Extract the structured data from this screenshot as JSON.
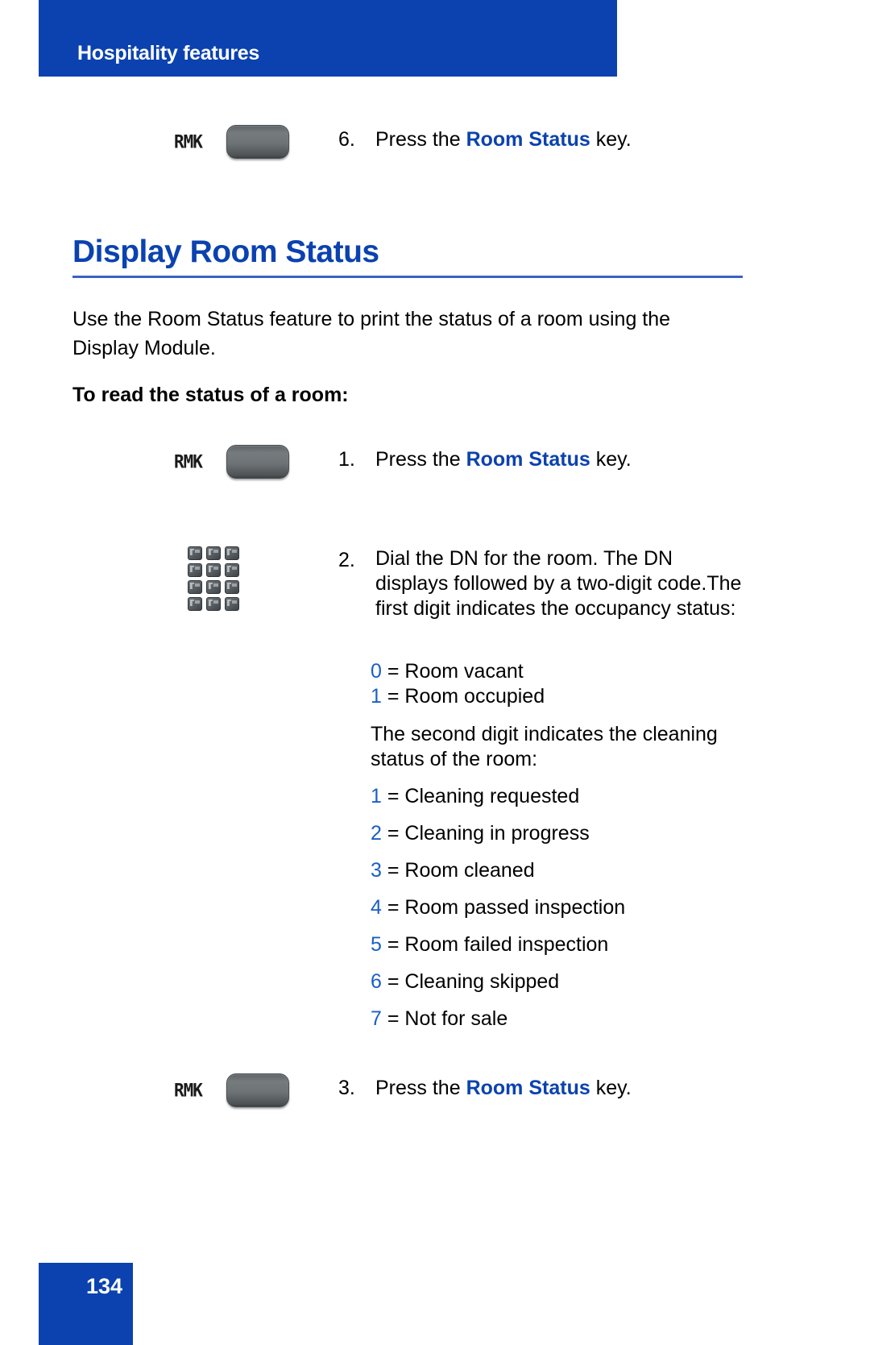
{
  "header": {
    "title": "Hospitality features"
  },
  "top_step": {
    "number": "6.",
    "icon_label": "RMK",
    "text_before": "Press the ",
    "keyword": "Room Status",
    "text_after": " key."
  },
  "section": {
    "heading": "Display Room Status",
    "intro": "Use the Room Status feature to print the status of a room using the Display Module.",
    "subheading": "To read the status of a room:"
  },
  "steps": [
    {
      "number": "1.",
      "icon": "soft-key",
      "icon_label": "RMK",
      "text_before": "Press the ",
      "keyword": "Room Status",
      "text_after": " key."
    },
    {
      "number": "2.",
      "icon": "keypad",
      "text": "Dial the DN for the room. The DN displays followed by a two-digit code.The first digit indicates the occupancy status:"
    },
    {
      "number": "3.",
      "icon": "soft-key",
      "icon_label": "RMK",
      "text_before": "Press the ",
      "keyword": "Room Status",
      "text_after": " key."
    }
  ],
  "occupancy_codes": [
    {
      "digit": "0",
      "sep": " = ",
      "label": "Room vacant"
    },
    {
      "digit": "1",
      "sep": " = ",
      "label": "Room occupied"
    }
  ],
  "cleaning_note": "The second digit indicates the cleaning status of the room:",
  "cleaning_codes": [
    {
      "digit": "1",
      "sep": " = ",
      "label": "Cleaning requested"
    },
    {
      "digit": "2",
      "sep": " = ",
      "label": "Cleaning in progress"
    },
    {
      "digit": "3",
      "sep": " = ",
      "label": "Room cleaned"
    },
    {
      "digit": "4",
      "sep": " = ",
      "label": "Room passed inspection"
    },
    {
      "digit": "5",
      "sep": " = ",
      "label": "Room failed inspection"
    },
    {
      "digit": "6",
      "sep": " = ",
      "label": "Cleaning skipped"
    },
    {
      "digit": "7",
      "sep": " = ",
      "label": "Not for sale"
    }
  ],
  "footer": {
    "page_number": "134"
  },
  "colors": {
    "brand_blue": "#0b42b0",
    "rule_blue": "#3a63c0",
    "digit_blue": "#1a5fc4"
  }
}
